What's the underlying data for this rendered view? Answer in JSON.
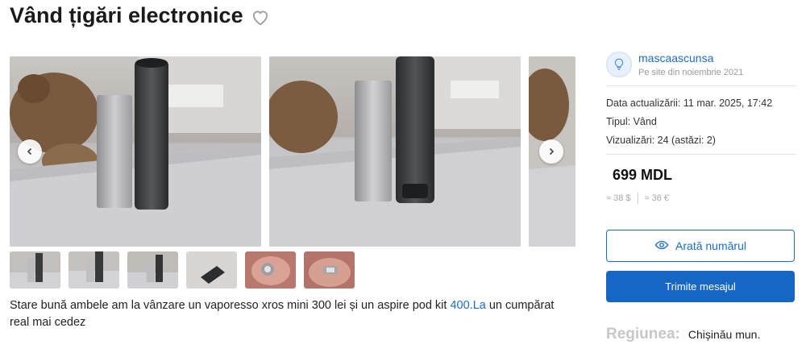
{
  "listing": {
    "title": "Vând țigări electronice",
    "description_before_link": " Stare bună ambele  am la vânzare un vaporesso xros mini 300 lei și un aspire pod kit ",
    "description_link": "400.La",
    "description_after_link": " un cumpărat real mai cedez"
  },
  "seller": {
    "name": "mascaascunsa",
    "since": "Pe site din noiembrie 2021"
  },
  "meta": {
    "updated": "Data actualizării: 11 mar. 2025, 17:42",
    "type": "Tipul: Vând",
    "views": "Vizualizări: 24 (astăzi: 2)"
  },
  "price": {
    "main": "699 MDL",
    "usd": "≈ 38 $",
    "eur": "≈ 36 €"
  },
  "actions": {
    "show_number": "Arată numărul",
    "send_message": "Trimite mesajul"
  },
  "region": {
    "label": "Regiunea:",
    "value": "Chișinău mun."
  },
  "icons": {
    "favorite": "heart-outline-icon",
    "prev": "chevron-left-icon",
    "next": "chevron-right-icon",
    "seller": "lightbulb-icon",
    "phone": "eye-icon"
  },
  "colors": {
    "accent": "#1a6cc7",
    "primary_button": "#1667c4"
  }
}
